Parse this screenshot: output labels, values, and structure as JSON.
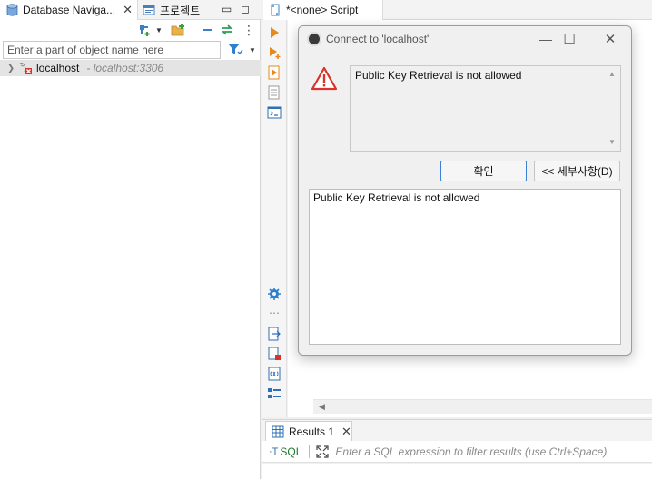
{
  "navigator": {
    "tabs": [
      {
        "label": "Database Naviga...",
        "icon": "database-icon",
        "close": "✕"
      },
      {
        "label": "프로젝트",
        "icon": "project-icon"
      }
    ],
    "filter_placeholder": "Enter a part of object name here",
    "tree": [
      {
        "name": "localhost",
        "host": "- localhost:3306",
        "icon": "mysql-connection-error-icon"
      }
    ]
  },
  "editor": {
    "tab_label": "*<none> Script",
    "results_tab_label": "Results 1",
    "results_close": "✕",
    "sql_label": "SQL",
    "results_filter_placeholder": "Enter a SQL expression to filter results (use Ctrl+Space)"
  },
  "dialog": {
    "title": "Connect to 'localhost'",
    "message": "Public Key Retrieval is not allowed",
    "ok_label": "확인",
    "details_label": "<< 세부사항(D)",
    "details_text": "Public Key Retrieval is not allowed"
  },
  "colors": {
    "accent": "#3b82d6",
    "warning": "#d9342b",
    "tree_selection": "#e4e4e4",
    "sql_green": "#1d7a2c"
  }
}
